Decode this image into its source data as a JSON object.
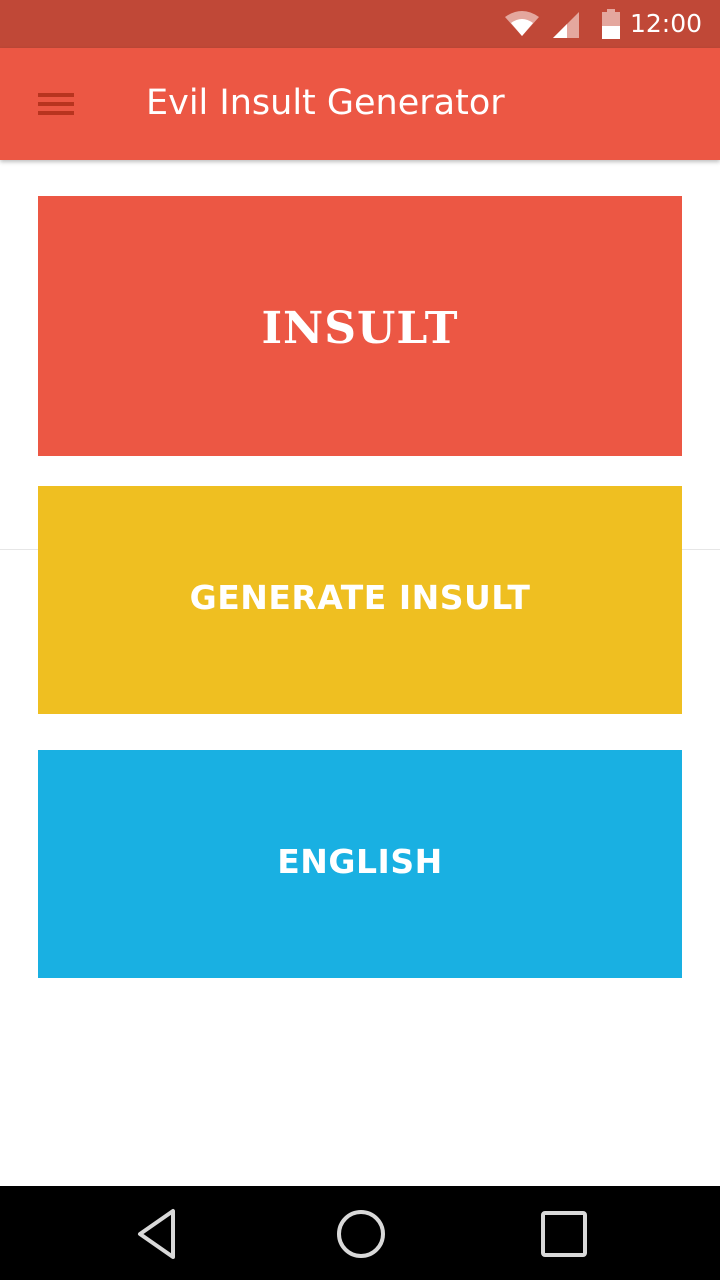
{
  "status_bar": {
    "time": "12:00",
    "icons": [
      "wifi-icon",
      "cell-signal-icon",
      "battery-icon"
    ],
    "background": "#c04837"
  },
  "app_bar": {
    "title": "Evil Insult Generator",
    "menu_icon": "hamburger-menu-icon",
    "background": "#ec5744"
  },
  "main": {
    "insult_card": {
      "text": "INSULT",
      "color": "#ec5744"
    },
    "generate_button": {
      "label": "GENERATE INSULT",
      "color": "#efbf21"
    },
    "language_button": {
      "label": "ENGLISH",
      "color": "#19b0e2"
    }
  },
  "nav_bar": {
    "icons": [
      "back-icon",
      "home-icon",
      "recents-icon"
    ]
  }
}
